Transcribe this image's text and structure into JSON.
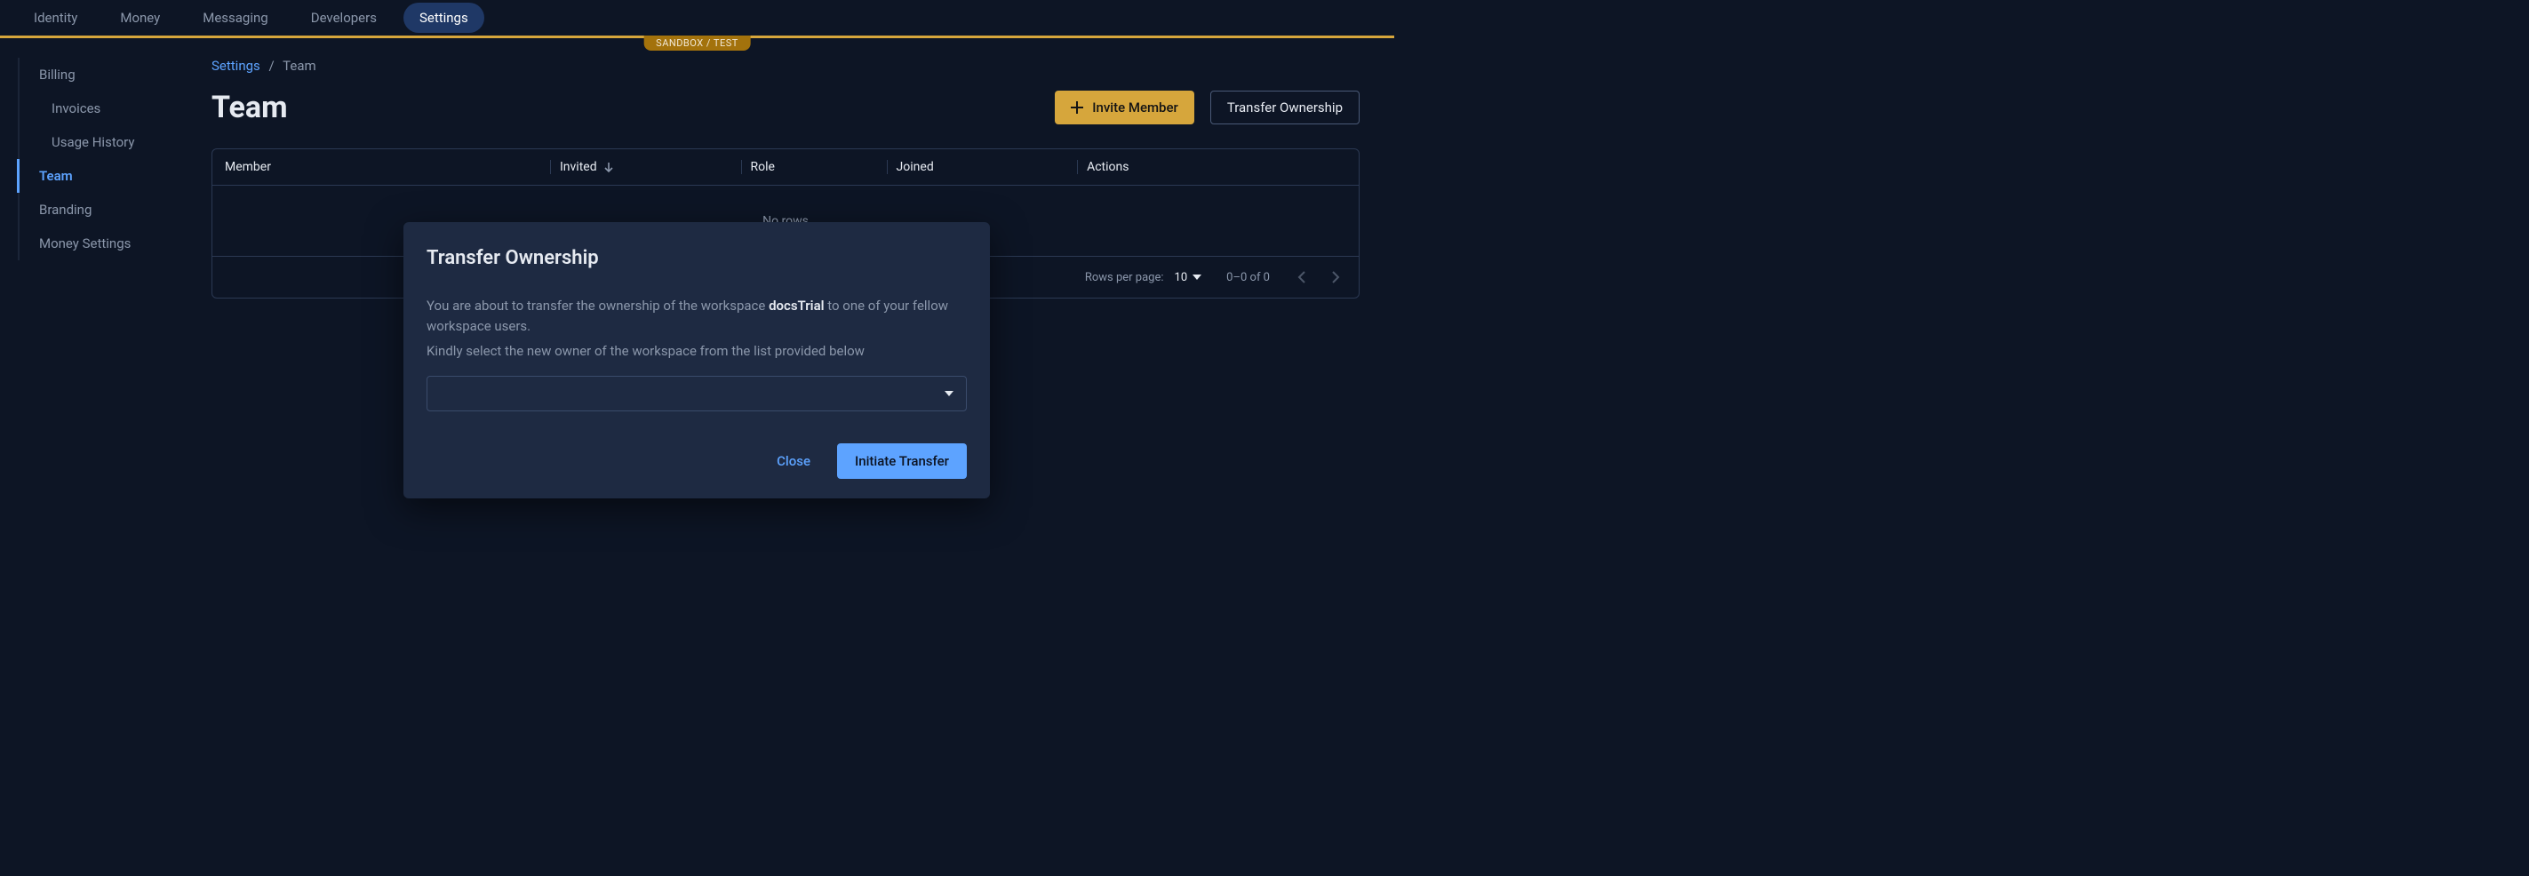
{
  "topnav": {
    "items": [
      "Identity",
      "Money",
      "Messaging",
      "Developers",
      "Settings"
    ],
    "active": "Settings"
  },
  "sandbox_badge": "SANDBOX / TEST",
  "sidebar": {
    "items": [
      {
        "label": "Billing",
        "type": "parent"
      },
      {
        "label": "Invoices",
        "type": "child"
      },
      {
        "label": "Usage History",
        "type": "child"
      },
      {
        "label": "Team",
        "type": "parent",
        "active": true
      },
      {
        "label": "Branding",
        "type": "parent"
      },
      {
        "label": "Money Settings",
        "type": "parent"
      }
    ]
  },
  "breadcrumb": {
    "root": "Settings",
    "sep": "/",
    "current": "Team"
  },
  "page": {
    "title": "Team",
    "invite_label": "Invite Member",
    "transfer_label": "Transfer Ownership"
  },
  "table": {
    "columns": {
      "member": "Member",
      "invited": "Invited",
      "role": "Role",
      "joined": "Joined",
      "actions": "Actions"
    },
    "empty_text": "No rows",
    "footer": {
      "rpp_label": "Rows per page:",
      "rpp_value": "10",
      "range": "0–0 of 0"
    }
  },
  "modal": {
    "title": "Transfer Ownership",
    "line1_pre": "You are about to transfer the ownership of the workspace ",
    "workspace": "docsTrial",
    "line1_post": " to one of your fellow workspace users.",
    "line2": "Kindly select the new owner of the workspace from the list provided below",
    "close_label": "Close",
    "initiate_label": "Initiate Transfer"
  }
}
